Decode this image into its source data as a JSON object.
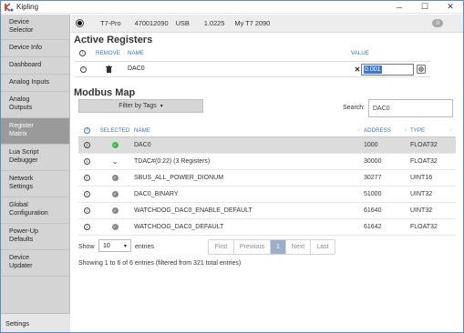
{
  "window": {
    "title": "Kipling",
    "minimize": "─",
    "maximize": "☐",
    "close": "✕"
  },
  "sidebar": {
    "items": [
      {
        "line1": "Device",
        "line2": "Selector"
      },
      {
        "line1": "Device Info",
        "line2": ""
      },
      {
        "line1": "Dashboard",
        "line2": ""
      },
      {
        "line1": "Analog Inputs",
        "line2": ""
      },
      {
        "line1": "Analog",
        "line2": "Outputs"
      },
      {
        "line1": "Register",
        "line2": "Matrix"
      },
      {
        "line1": "Lua Script",
        "line2": "Debugger"
      },
      {
        "line1": "Network",
        "line2": "Settings"
      },
      {
        "line1": "Global",
        "line2": "Configuration"
      },
      {
        "line1": "Power-Up",
        "line2": "Defaults"
      },
      {
        "line1": "Device",
        "line2": "Updater"
      }
    ],
    "settings": "Settings"
  },
  "device": {
    "name": "T7-Pro",
    "serial": "470012090",
    "connection": "USB",
    "firmware": "1.0225",
    "label": "My T7 2090",
    "badge": "0"
  },
  "active_registers": {
    "title": "Active Registers",
    "headers": {
      "remove": "REMOVE",
      "name": "NAME",
      "value": "VALUE"
    },
    "row": {
      "name": "DAC0",
      "value": "0.001"
    }
  },
  "modbus_map": {
    "title": "Modbus Map",
    "filter_button": "Filter by Tags",
    "search_label": "Search:",
    "search_value": "DAC0",
    "headers": {
      "selected": "SELECTED",
      "name": "NAME",
      "address": "ADDRESS",
      "type": "TYPE"
    },
    "rows": [
      {
        "name": "DAC0",
        "address": "1000",
        "type": "FLOAT32"
      },
      {
        "name": "TDAC#(0:22) (3 Registers)",
        "address": "30000",
        "type": "FLOAT32"
      },
      {
        "name": "SBUS_ALL_POWER_DIONUM",
        "address": "30277",
        "type": "UINT16"
      },
      {
        "name": "DAC0_BINARY",
        "address": "51000",
        "type": "UINT32"
      },
      {
        "name": "WATCHDOG_DAC0_ENABLE_DEFAULT",
        "address": "61640",
        "type": "UINT32"
      },
      {
        "name": "WATCHDOG_DAC0_DEFAULT",
        "address": "61642",
        "type": "FLOAT32"
      }
    ],
    "show_label": "Show",
    "show_value": "10",
    "entries_label": "entries",
    "pager": {
      "first": "First",
      "previous": "Previous",
      "current": "1",
      "next": "Next",
      "last": "Last"
    },
    "info": "Showing 1 to 6 of 6 entries (filtered from 321 total entries)"
  }
}
